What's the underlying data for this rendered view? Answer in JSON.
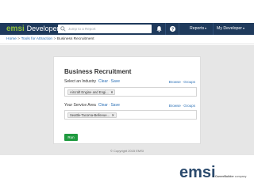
{
  "topbar": {
    "brand": "emsi",
    "product": "Developer",
    "search_placeholder": "Jump to a Report",
    "reports_label": "Reports",
    "account_label": "My Developer",
    "colors": {
      "bar": "#1f3a5c",
      "brand_green": "#8fc13e"
    }
  },
  "breadcrumb": {
    "items": [
      "Home",
      "Tools for Attraction",
      "Business Recruitment"
    ],
    "separator": ">"
  },
  "form": {
    "title": "Business Recruitment",
    "industry": {
      "label": "Select an Industry",
      "clear": "Clear",
      "save": "Save",
      "browse": "Browse",
      "groups": "Groups",
      "chip": "Aircraft Engine and Engi..."
    },
    "service_area": {
      "label": "Your Service Area",
      "clear": "Clear",
      "save": "Save",
      "browse": "Browse",
      "groups": "Groups",
      "chip": "Seattle-Tacoma-Bellevue..."
    },
    "run_button": "Run",
    "dot": "·",
    "remove": "×"
  },
  "copyright": "© Copyright 2015 EMSI",
  "footer": {
    "logo_text": "emsi",
    "company_prefix": "a",
    "company_name": "CareerBuilder",
    "company_suffix": "company"
  }
}
